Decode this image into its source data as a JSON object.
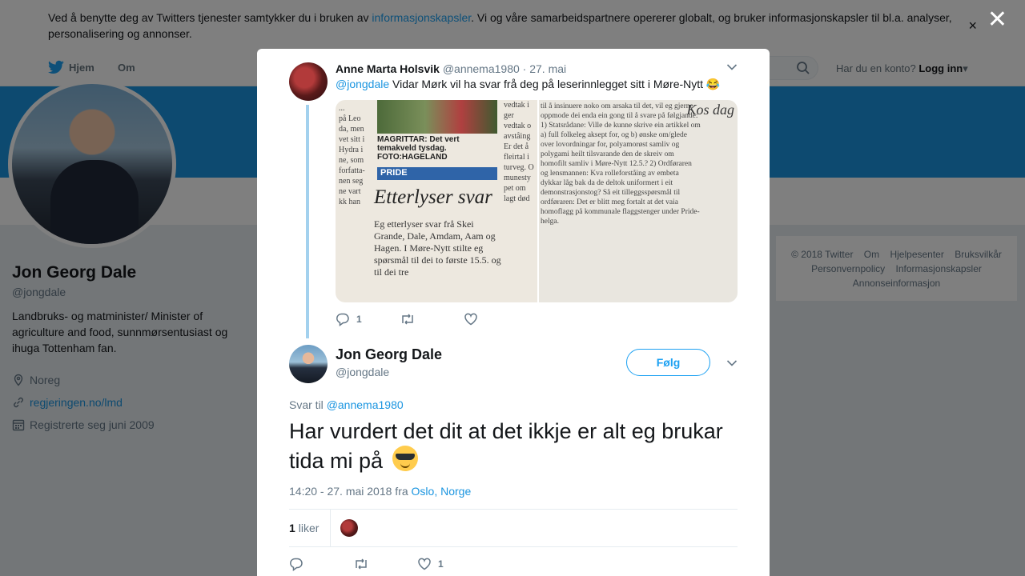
{
  "cookie": {
    "text_before": "Ved å benytte deg av Twitters tjenester samtykker du i bruken av ",
    "link": "informasjonskapsler",
    "text_after": ". Vi og våre samarbeidspartnere opererer globalt, og bruker informasjonskapsler til bl.a. analyser, personalisering og annonser.",
    "close": "×"
  },
  "nav": {
    "home": "Hjem",
    "about": "Om",
    "account_prompt": "Har du en konto?",
    "login": "Logg inn",
    "caret": "▾"
  },
  "profile": {
    "name": "Jon Georg Dale",
    "handle": "@jongdale",
    "bio": "Landbruks- og matminister/ Minister of agriculture and food, sunnmørsentusiast og ihuga Tottenham fan.",
    "location": "Noreg",
    "url": "regjeringen.no/lmd",
    "joined": "Registrerte seg juni 2009"
  },
  "footer": {
    "links": [
      "© 2018 Twitter",
      "Om",
      "Hjelpesenter",
      "Bruksvilkår",
      "Personvernpolicy",
      "Informasjonskapsler",
      "Annonseinformasjon"
    ]
  },
  "overlay": {
    "close": "✕"
  },
  "parent_tweet": {
    "name": "Anne Marta Holsvik",
    "handle": "@annema1980",
    "date": "· 27. mai",
    "mention": "@jongdale",
    "text": " Vidar Mørk vil ha svar frå deg på leserinnlegget sitt i Møre-Nytt 😂",
    "replies": "1",
    "retweets": "",
    "likes": "",
    "image": {
      "caption": "MAGRITTAR: Det vert temakveld tysdag. FOTO:HAGELAND",
      "tag": "PRIDE",
      "headline": "Etterlyser svar",
      "body": "Eg etterlyser svar frå Skei Grande, Dale, Amdam, Aam og Hagen. I Møre-Nytt stilte eg spørsmål til dei to første 15.5. og til dei tre",
      "right_title": "Kos dag"
    }
  },
  "tweet": {
    "name": "Jon Georg Dale",
    "handle": "@jongdale",
    "follow": "Følg",
    "reply_prefix": "Svar til ",
    "reply_to": "@annema1980",
    "text": "Har vurdert det dit at det ikkje er alt eg brukar tida mi på",
    "timestamp": "14:20 - 27. mai 2018 fra ",
    "location": "Oslo, Norge",
    "likes_count": "1",
    "likes_label": "liker",
    "replies": "",
    "retweets": "",
    "likes": "1"
  }
}
